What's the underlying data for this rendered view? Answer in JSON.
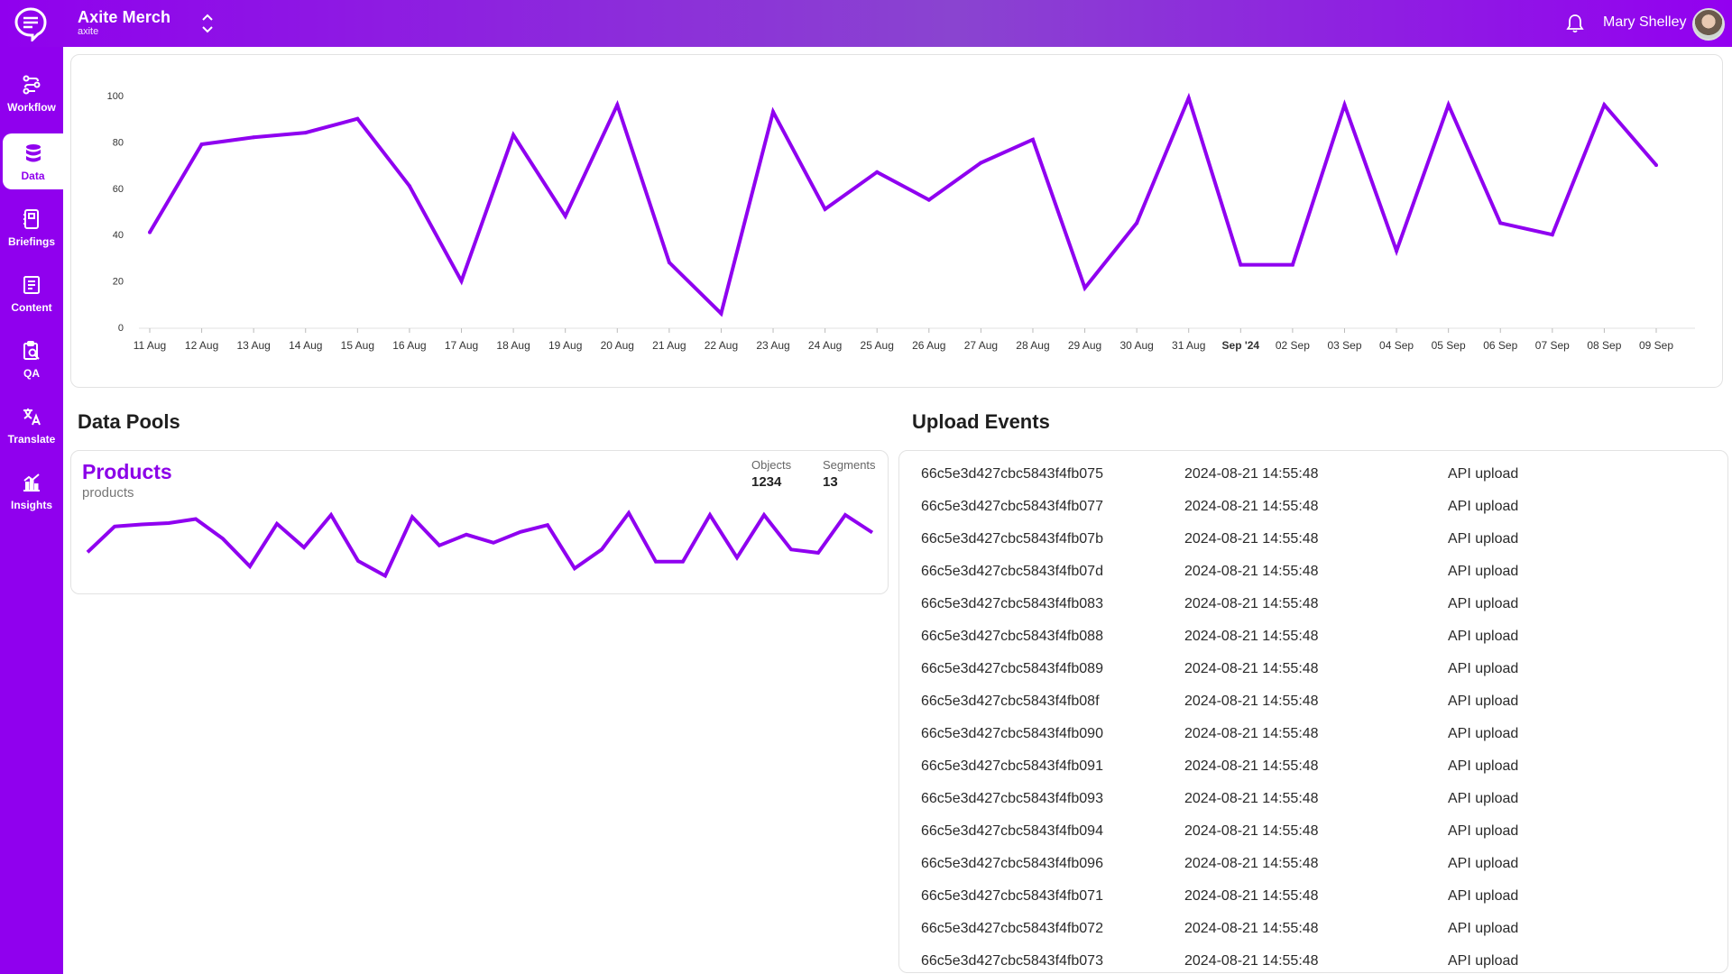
{
  "header": {
    "org_name": "Axite Merch",
    "org_slug": "axite",
    "user_name": "Mary Shelley",
    "icons": {
      "logo": "chat-logo-icon",
      "switch": "chevron-up-down-icon",
      "bell": "bell-icon"
    }
  },
  "sidebar": {
    "items": [
      {
        "label": "Workflow",
        "icon": "workflow-icon",
        "active": false
      },
      {
        "label": "Data",
        "icon": "database-icon",
        "active": true
      },
      {
        "label": "Briefings",
        "icon": "briefing-icon",
        "active": false
      },
      {
        "label": "Content",
        "icon": "content-icon",
        "active": false
      },
      {
        "label": "QA",
        "icon": "qa-icon",
        "active": false
      },
      {
        "label": "Translate",
        "icon": "translate-icon",
        "active": false
      },
      {
        "label": "Insights",
        "icon": "insights-icon",
        "active": false
      }
    ]
  },
  "colors": {
    "accent": "#9000ee",
    "line": "#8f00f0",
    "grid": "#e0e0e0"
  },
  "chart_data": {
    "type": "line",
    "x": [
      "11 Aug",
      "12 Aug",
      "13 Aug",
      "14 Aug",
      "15 Aug",
      "16 Aug",
      "17 Aug",
      "18 Aug",
      "19 Aug",
      "20 Aug",
      "21 Aug",
      "22 Aug",
      "23 Aug",
      "24 Aug",
      "25 Aug",
      "26 Aug",
      "27 Aug",
      "28 Aug",
      "29 Aug",
      "30 Aug",
      "31 Aug",
      "Sep '24",
      "02 Sep",
      "03 Sep",
      "04 Sep",
      "05 Sep",
      "06 Sep",
      "07 Sep",
      "08 Sep",
      "09 Sep"
    ],
    "series": [
      {
        "values": [
          41,
          79,
          82,
          84,
          90,
          61,
          20,
          83,
          48,
          96,
          28,
          6,
          93,
          51,
          67,
          55,
          71,
          81,
          17,
          45,
          99,
          27,
          27,
          96,
          33,
          96,
          45,
          40,
          96,
          70
        ]
      }
    ],
    "ylim": [
      0,
      100
    ],
    "yticks": [
      0,
      20,
      40,
      60,
      80,
      100
    ],
    "grid": false,
    "bold_tick": "Sep '24"
  },
  "data_pools": {
    "title": "Data Pools",
    "items": [
      {
        "name": "Products",
        "id": "products",
        "objects_label": "Objects",
        "objects": "1234",
        "segments_label": "Segments",
        "segments": "13",
        "sparkline": [
          41,
          79,
          82,
          84,
          90,
          61,
          20,
          83,
          48,
          96,
          28,
          6,
          93,
          51,
          67,
          55,
          71,
          81,
          17,
          45,
          99,
          27,
          27,
          96,
          33,
          96,
          45,
          40,
          96,
          70
        ]
      }
    ]
  },
  "upload_events": {
    "title": "Upload Events",
    "rows": [
      {
        "id": "66c5e3d427cbc5843f4fb075",
        "time": "2024-08-21 14:55:48",
        "type": "API upload"
      },
      {
        "id": "66c5e3d427cbc5843f4fb077",
        "time": "2024-08-21 14:55:48",
        "type": "API upload"
      },
      {
        "id": "66c5e3d427cbc5843f4fb07b",
        "time": "2024-08-21 14:55:48",
        "type": "API upload"
      },
      {
        "id": "66c5e3d427cbc5843f4fb07d",
        "time": "2024-08-21 14:55:48",
        "type": "API upload"
      },
      {
        "id": "66c5e3d427cbc5843f4fb083",
        "time": "2024-08-21 14:55:48",
        "type": "API upload"
      },
      {
        "id": "66c5e3d427cbc5843f4fb088",
        "time": "2024-08-21 14:55:48",
        "type": "API upload"
      },
      {
        "id": "66c5e3d427cbc5843f4fb089",
        "time": "2024-08-21 14:55:48",
        "type": "API upload"
      },
      {
        "id": "66c5e3d427cbc5843f4fb08f",
        "time": "2024-08-21 14:55:48",
        "type": "API upload"
      },
      {
        "id": "66c5e3d427cbc5843f4fb090",
        "time": "2024-08-21 14:55:48",
        "type": "API upload"
      },
      {
        "id": "66c5e3d427cbc5843f4fb091",
        "time": "2024-08-21 14:55:48",
        "type": "API upload"
      },
      {
        "id": "66c5e3d427cbc5843f4fb093",
        "time": "2024-08-21 14:55:48",
        "type": "API upload"
      },
      {
        "id": "66c5e3d427cbc5843f4fb094",
        "time": "2024-08-21 14:55:48",
        "type": "API upload"
      },
      {
        "id": "66c5e3d427cbc5843f4fb096",
        "time": "2024-08-21 14:55:48",
        "type": "API upload"
      },
      {
        "id": "66c5e3d427cbc5843f4fb071",
        "time": "2024-08-21 14:55:48",
        "type": "API upload"
      },
      {
        "id": "66c5e3d427cbc5843f4fb072",
        "time": "2024-08-21 14:55:48",
        "type": "API upload"
      },
      {
        "id": "66c5e3d427cbc5843f4fb073",
        "time": "2024-08-21 14:55:48",
        "type": "API upload"
      }
    ]
  }
}
